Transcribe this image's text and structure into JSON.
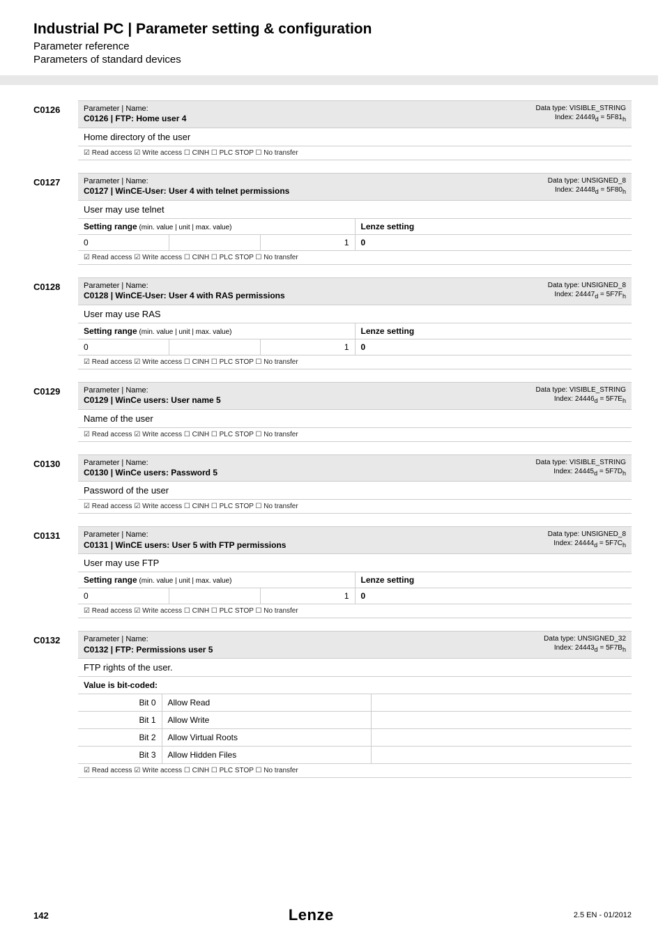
{
  "page": {
    "mainTitle": "Industrial PC | Parameter setting & configuration",
    "subtitle1": "Parameter reference",
    "subtitle2": "Parameters of standard devices",
    "pageNumber": "142",
    "logoText": "Lenze",
    "docVersion": "2.5 EN - 01/2012"
  },
  "labels": {
    "paramNameLabel": "Parameter | Name:",
    "settingRange": "Setting range",
    "settingRangeSub": " (min. value | unit | max. value)",
    "lenzeSetting": "Lenze setting",
    "valueBitCoded": "Value is bit-coded:",
    "accessLine": "☑ Read access   ☑ Write access   ☐ CINH   ☐ PLC STOP   ☐ No transfer"
  },
  "params": [
    {
      "id": "C0126",
      "name": "C0126 | FTP: Home user 4",
      "dataType": "Data type: VISIBLE_STRING",
      "index": "Index: 24449d = 5F81h",
      "desc": "Home directory of the user",
      "kind": "simple"
    },
    {
      "id": "C0127",
      "name": "C0127 | WinCE-User: User 4 with telnet permissions",
      "dataType": "Data type: UNSIGNED_8",
      "index": "Index: 24448d = 5F80h",
      "desc": "User may use telnet",
      "kind": "range",
      "min": "0",
      "max": "1",
      "lenze": "0"
    },
    {
      "id": "C0128",
      "name": "C0128 | WinCE-User: User 4 with RAS permissions",
      "dataType": "Data type: UNSIGNED_8",
      "index": "Index: 24447d = 5F7Fh",
      "desc": "User may use RAS",
      "kind": "range",
      "min": "0",
      "max": "1",
      "lenze": "0"
    },
    {
      "id": "C0129",
      "name": "C0129 | WinCe users: User name 5",
      "dataType": "Data type: VISIBLE_STRING",
      "index": "Index: 24446d = 5F7Eh",
      "desc": "Name of the user",
      "kind": "simple"
    },
    {
      "id": "C0130",
      "name": "C0130 | WinCe users: Password 5",
      "dataType": "Data type: VISIBLE_STRING",
      "index": "Index: 24445d = 5F7Dh",
      "desc": "Password of the user",
      "kind": "simple"
    },
    {
      "id": "C0131",
      "name": "C0131 | WinCE users: User 5 with FTP permissions",
      "dataType": "Data type: UNSIGNED_8",
      "index": "Index: 24444d = 5F7Ch",
      "desc": "User may use FTP",
      "kind": "range",
      "min": "0",
      "max": "1",
      "lenze": "0"
    },
    {
      "id": "C0132",
      "name": "C0132 | FTP: Permissions user 5",
      "dataType": "Data type: UNSIGNED_32",
      "index": "Index: 24443d = 5F7Bh",
      "desc": "FTP rights of the user.",
      "kind": "bits",
      "bits": [
        {
          "bit": "Bit 0",
          "label": "Allow Read"
        },
        {
          "bit": "Bit 1",
          "label": "Allow Write"
        },
        {
          "bit": "Bit 2",
          "label": "Allow Virtual Roots"
        },
        {
          "bit": "Bit 3",
          "label": "Allow Hidden Files"
        }
      ]
    }
  ]
}
